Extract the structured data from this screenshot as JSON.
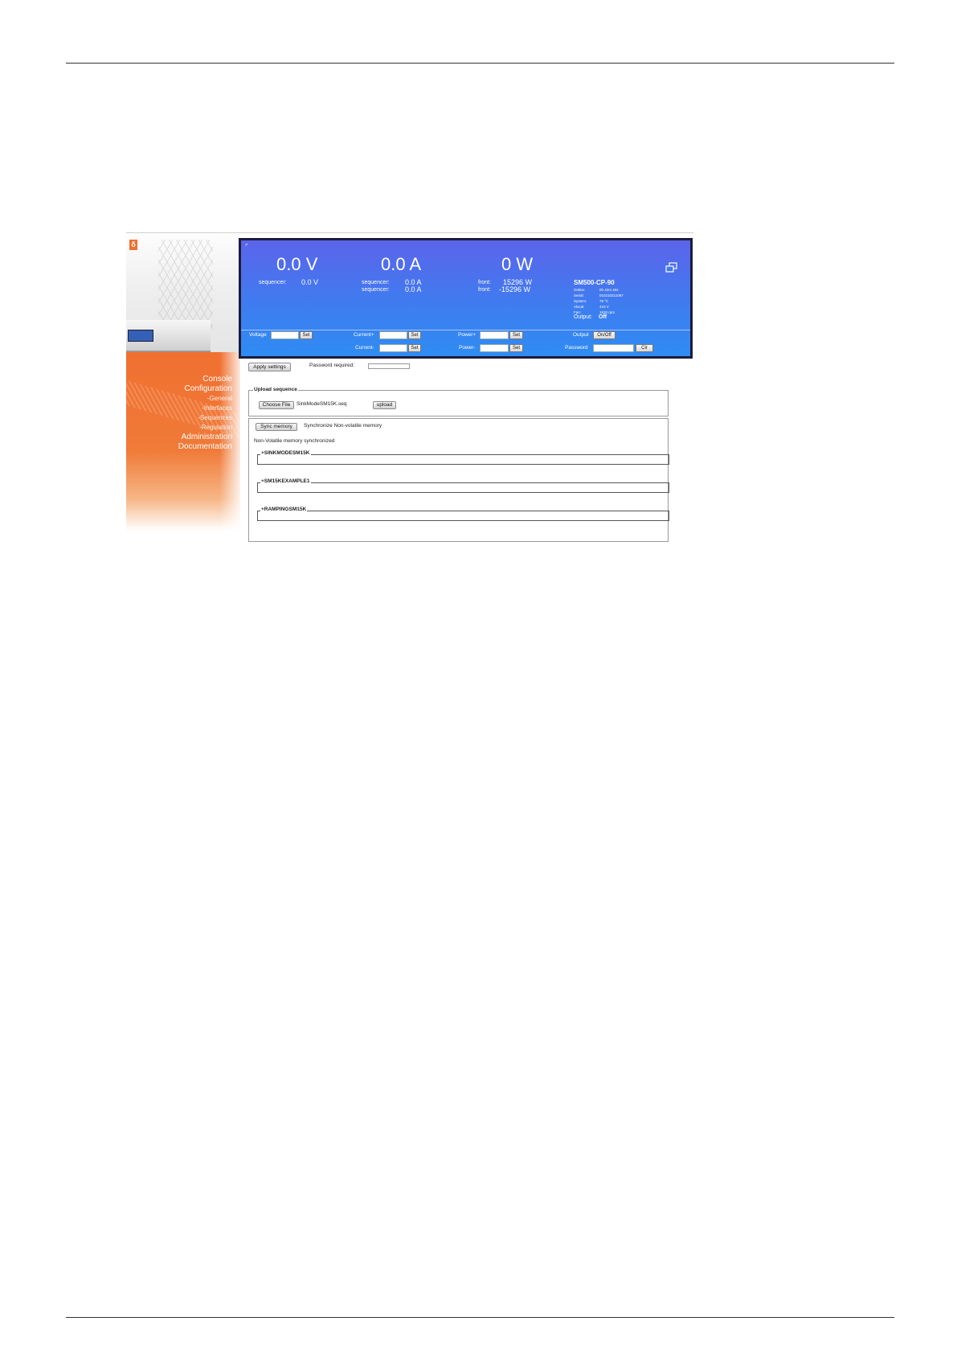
{
  "sidebar": {
    "nav": [
      {
        "label": "Console",
        "level": "main"
      },
      {
        "label": "Configuration",
        "level": "main"
      },
      {
        "label": "-General",
        "level": "sub"
      },
      {
        "label": "-Interfaces",
        "level": "sub"
      },
      {
        "label": "-Sequences",
        "level": "sub"
      },
      {
        "label": "-Regulation",
        "level": "sub"
      },
      {
        "label": "Administration",
        "level": "main"
      },
      {
        "label": "Documentation",
        "level": "main"
      }
    ]
  },
  "readouts": {
    "voltage": {
      "value": "0.0 V",
      "seq_label": "sequencer:",
      "seq_value": "0.0 V"
    },
    "current": {
      "value": "0.0 A",
      "rows": [
        {
          "label": "sequencer:",
          "value": "0.0 A"
        },
        {
          "label": "sequencer:",
          "value": "0.0 A"
        }
      ]
    },
    "power": {
      "value": "0 W",
      "rows": [
        {
          "label": "front:",
          "value": "15296 W"
        },
        {
          "label": "front:",
          "value": "-15296 W"
        }
      ]
    }
  },
  "device": {
    "model": "SM500-CP-90",
    "stats": [
      {
        "key": "Online:",
        "value": "0h 42m 40s"
      },
      {
        "key": "Serial:",
        "value": "010210211097"
      },
      {
        "key": "System:",
        "value": "78 °C"
      },
      {
        "key": "Vlocal:",
        "value": "410 V"
      },
      {
        "key": "Fan:",
        "value": "1620 rpm"
      }
    ],
    "output_label": "Output:",
    "output_value": "Off"
  },
  "controls": {
    "voltage_label": "Voltage",
    "current_plus_label": "Current+",
    "current_minus_label": "Current-",
    "power_plus_label": "Power+",
    "power_minus_label": "Power-",
    "set_label": "Set",
    "output_label": "Output",
    "onoff_label": "On/Off",
    "password_label": "Password",
    "clr_label": "Clr"
  },
  "form": {
    "apply_label": "Apply settings",
    "password_required": "Password required:",
    "upload": {
      "legend": "Upload sequence",
      "choose_label": "Choose File",
      "file_name": "SinkModeSM15K.seq",
      "upload_label": "upload"
    },
    "sync": {
      "button_label": "Sync memory",
      "description": "Synchronize Non-volatile memory",
      "status": "Non-Volatile memory synchronized"
    },
    "sequences": [
      "+SINKMODESM15K",
      "+SM15KEXAMPLE1",
      "+RAMPINGSM15K"
    ]
  }
}
